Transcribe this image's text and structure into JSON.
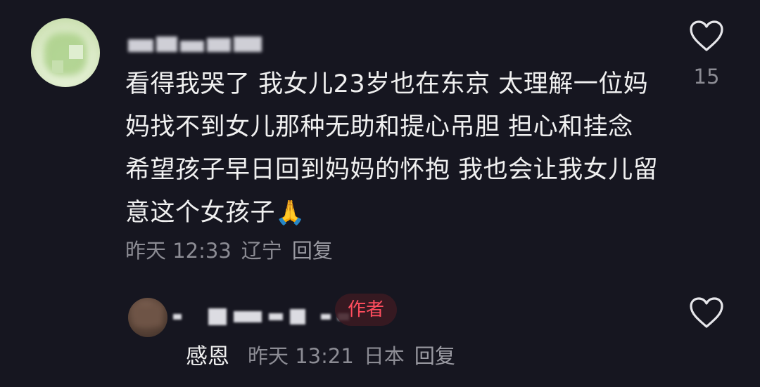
{
  "comment": {
    "text": "看得我哭了 我女儿23岁也在东京 太理解一位妈妈找不到女儿那种无助和提心吊胆 担心和挂念 希望孩子早日回到妈妈的怀抱 我也会让我女儿留意这个女孩子",
    "emoji": "🙏",
    "time": "昨天 12:33",
    "location": "辽宁",
    "reply_label": "回复",
    "like_count": "15",
    "like_icon": "heart-outline-icon"
  },
  "reply": {
    "badge": "作者",
    "text": "感恩",
    "time": "昨天 13:21",
    "location": "日本",
    "reply_label": "回复",
    "like_icon": "heart-outline-icon"
  },
  "colors": {
    "background": "#161620",
    "text_primary": "#F0F0F0",
    "text_secondary": "#8C8C94",
    "author_badge": "#FF4D5E"
  }
}
